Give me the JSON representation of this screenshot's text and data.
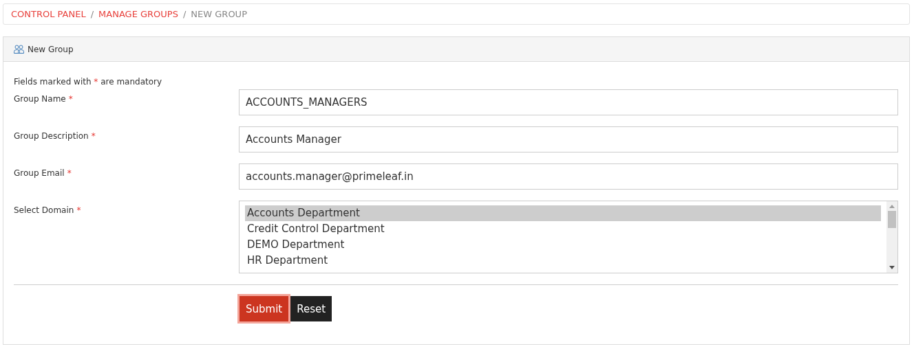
{
  "breadcrumb": [
    {
      "label": "CONTROL PANEL",
      "link": true
    },
    {
      "label": "MANAGE GROUPS",
      "link": true
    },
    {
      "label": "NEW GROUP",
      "link": false
    }
  ],
  "separator": "/",
  "panel": {
    "title": "New Group"
  },
  "form": {
    "note": {
      "before": "Fields marked with",
      "mark": "*",
      "after": "are mandatory"
    },
    "fields": [
      {
        "kind": "text",
        "label": "Group Name",
        "required": true,
        "required_mark": "*",
        "value": "ACCOUNTS_MANAGERS"
      },
      {
        "kind": "text",
        "label": "Group Description",
        "required": true,
        "required_mark": "*",
        "value": "Accounts Manager"
      },
      {
        "kind": "text",
        "label": "Group Email",
        "required": true,
        "required_mark": "*",
        "value": "accounts.manager@primeleaf.in"
      },
      {
        "kind": "list",
        "label": "Select Domain",
        "required": true,
        "required_mark": "*",
        "options": [
          {
            "label": "Accounts Department",
            "selected": true
          },
          {
            "label": "Credit Control Department",
            "selected": false
          },
          {
            "label": "DEMO Department",
            "selected": false
          },
          {
            "label": "HR Department",
            "selected": false
          }
        ]
      }
    ],
    "buttons": [
      {
        "kind": "primary",
        "label": "Submit",
        "focused": true
      },
      {
        "kind": "dark",
        "label": "Reset",
        "focused": false
      }
    ]
  }
}
